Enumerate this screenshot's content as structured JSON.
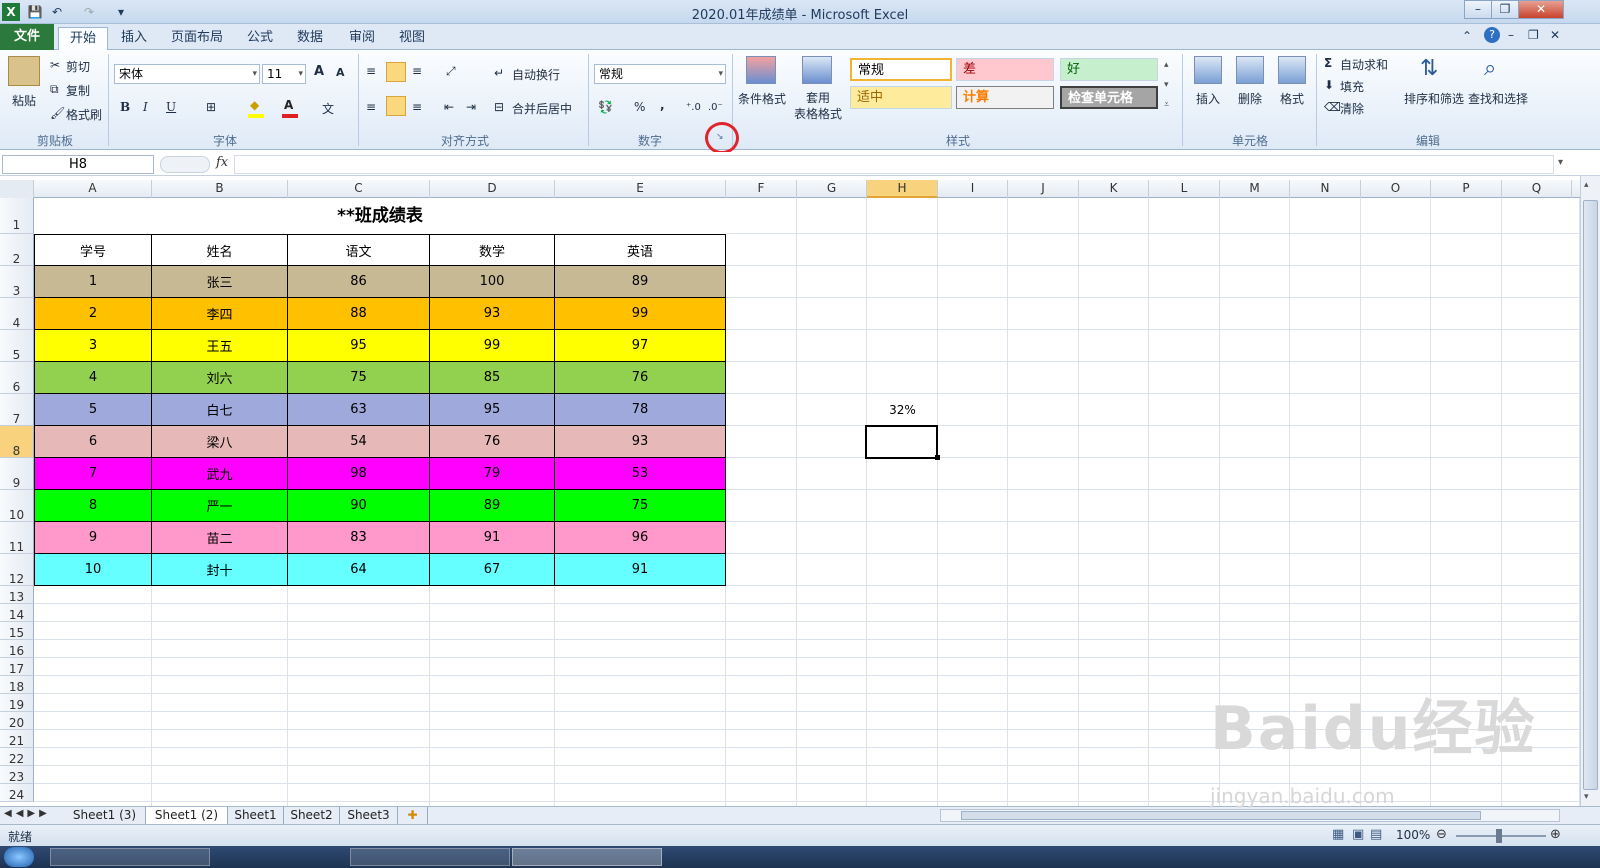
{
  "window": {
    "title": "2020.01年成绩单 - Microsoft Excel"
  },
  "quick_access": {
    "undo_icon": "↶",
    "redo_icon": "↷",
    "save_icon": "💾"
  },
  "tabs": [
    {
      "label": "文件"
    },
    {
      "label": "开始"
    },
    {
      "label": "插入"
    },
    {
      "label": "页面布局"
    },
    {
      "label": "公式"
    },
    {
      "label": "数据"
    },
    {
      "label": "审阅"
    },
    {
      "label": "视图"
    }
  ],
  "ribbon": {
    "clipboard": {
      "paste": "粘贴",
      "cut": "剪切",
      "copy": "复制",
      "format_painter": "格式刷",
      "group": "剪贴板"
    },
    "font": {
      "name": "宋体",
      "size": "11",
      "group": "字体"
    },
    "alignment": {
      "wrap": "自动换行",
      "merge": "合并后居中",
      "group": "对齐方式"
    },
    "number": {
      "format": "常规",
      "percent": "%",
      "comma": ",",
      "group": "数字"
    },
    "styles": {
      "conditional": "条件格式",
      "table_format": "套用\n表格格式",
      "normal": "常规",
      "bad": "差",
      "good": "好",
      "neutral": "适中",
      "calc": "计算",
      "check": "检查单元格",
      "group": "样式"
    },
    "cells": {
      "insert": "插入",
      "delete": "删除",
      "format": "格式",
      "group": "单元格"
    },
    "editing": {
      "autosum": "自动求和",
      "fill": "填充",
      "clear": "清除",
      "sort": "排序和筛选",
      "find": "查找和选择",
      "group": "编辑"
    }
  },
  "formula_bar": {
    "name_box": "H8",
    "fx": "fx",
    "value": ""
  },
  "columns": [
    "A",
    "B",
    "C",
    "D",
    "E",
    "F",
    "G",
    "H",
    "I",
    "J",
    "K",
    "L",
    "M",
    "N",
    "O",
    "P",
    "Q"
  ],
  "rows": [
    "1",
    "2",
    "3",
    "4",
    "5",
    "6",
    "7",
    "8",
    "9",
    "10",
    "11",
    "12",
    "13",
    "14",
    "15",
    "16",
    "17",
    "18",
    "19",
    "20",
    "21",
    "22",
    "23",
    "24"
  ],
  "sheet": {
    "title": "**班成绩表",
    "headers": [
      "学号",
      "姓名",
      "语文",
      "数学",
      "英语"
    ],
    "data": [
      {
        "values": [
          "1",
          "张三",
          "86",
          "100",
          "89"
        ],
        "color": "#c8b995"
      },
      {
        "values": [
          "2",
          "李四",
          "88",
          "93",
          "99"
        ],
        "color": "#ffc000"
      },
      {
        "values": [
          "3",
          "王五",
          "95",
          "99",
          "97"
        ],
        "color": "#ffff00"
      },
      {
        "values": [
          "4",
          "刘六",
          "75",
          "85",
          "76"
        ],
        "color": "#92d050"
      },
      {
        "values": [
          "5",
          "白七",
          "63",
          "95",
          "78"
        ],
        "color": "#a0a9dc"
      },
      {
        "values": [
          "6",
          "梁八",
          "54",
          "76",
          "93"
        ],
        "color": "#e6b8b7"
      },
      {
        "values": [
          "7",
          "武九",
          "98",
          "79",
          "53"
        ],
        "color": "#ff00ff"
      },
      {
        "values": [
          "8",
          "严一",
          "90",
          "89",
          "75"
        ],
        "color": "#00ff00"
      },
      {
        "values": [
          "9",
          "苗二",
          "83",
          "91",
          "96"
        ],
        "color": "#ff99cc"
      },
      {
        "values": [
          "10",
          "封十",
          "64",
          "67",
          "91"
        ],
        "color": "#66ffff"
      }
    ],
    "h7_value": "32%"
  },
  "sheet_tabs": [
    "Sheet1 (3)",
    "Sheet1 (2)",
    "Sheet1",
    "Sheet2",
    "Sheet3"
  ],
  "status": {
    "ready": "就绪",
    "zoom": "100%"
  },
  "watermark": {
    "brand": "Baidu经验",
    "url": "jingyan.baidu.com"
  }
}
